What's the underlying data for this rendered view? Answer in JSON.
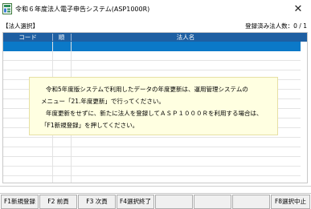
{
  "window": {
    "title": "令和６年度法人電子申告システム(ASP1000R)",
    "close_glyph": "✕",
    "icon": "app-icon"
  },
  "header": {
    "section_title": "【法人選択】",
    "registered_count": "登録済み法人数：0 / 1"
  },
  "grid": {
    "columns": [
      "コード",
      "順",
      "法人名"
    ],
    "selected_row": 0,
    "header_color": "#1e5fa2",
    "selected_color": "#0b79c8"
  },
  "message": {
    "lines": [
      "令和5年度版システムで利用したデータの年度更新は、運用管理システムの",
      "メニュー「21.年度更新」で行ってください。",
      "年度更新をせずに、新たに法人を登録してＡＳＰ１０００Ｒを利用する場合は、",
      "「F1新規登録」を押してください。"
    ],
    "background": "#ffffe1"
  },
  "function_keys": [
    {
      "label": "F1新規登録"
    },
    {
      "label": "F2 前頁"
    },
    {
      "label": "F3 次頁"
    },
    {
      "label": "F4選択終了"
    },
    {
      "label": ""
    },
    {
      "label": ""
    },
    {
      "label": ""
    },
    {
      "label": "F8選択中止"
    }
  ]
}
